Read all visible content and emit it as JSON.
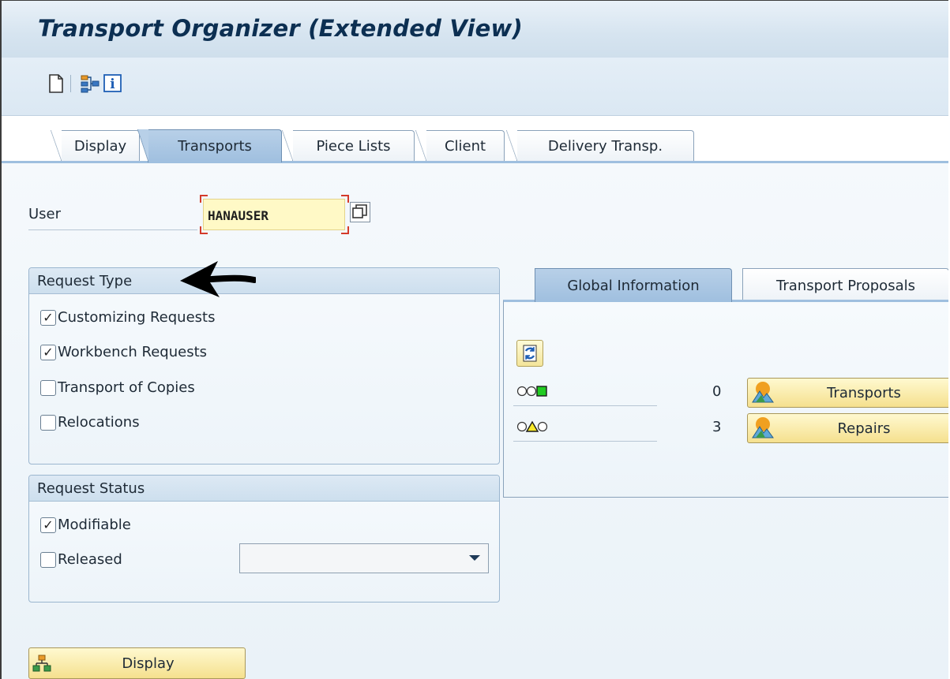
{
  "window": {
    "title": "Transport Organizer (Extended View)"
  },
  "toolbar": {
    "icons": [
      "new-document-icon",
      "hierarchy-icon",
      "info-icon"
    ]
  },
  "tabs": [
    {
      "label": "Display",
      "active": false
    },
    {
      "label": "Transports",
      "active": true
    },
    {
      "label": "Piece Lists",
      "active": false
    },
    {
      "label": "Client",
      "active": false
    },
    {
      "label": "Delivery Transp.",
      "active": false
    }
  ],
  "user": {
    "label": "User",
    "value": "HANAUSER"
  },
  "request_type": {
    "title": "Request Type",
    "items": [
      {
        "label": "Customizing Requests",
        "checked": true
      },
      {
        "label": "Workbench Requests",
        "checked": true
      },
      {
        "label": "Transport of Copies",
        "checked": false
      },
      {
        "label": "Relocations",
        "checked": false
      }
    ]
  },
  "request_status": {
    "title": "Request Status",
    "items": [
      {
        "label": "Modifiable",
        "checked": true
      },
      {
        "label": "Released",
        "checked": false
      }
    ],
    "released_dropdown_value": ""
  },
  "right_tabs": [
    {
      "label": "Global Information",
      "active": true
    },
    {
      "label": "Transport Proposals",
      "active": false
    }
  ],
  "global_info": {
    "rows": [
      {
        "status_icon": "green-status-lights-icon",
        "count": "0",
        "button": "Transports"
      },
      {
        "status_icon": "yellow-status-lights-icon",
        "count": "3",
        "button": "Repairs"
      }
    ]
  },
  "display_button": {
    "label": "Display"
  },
  "colors": {
    "title_text": "#0c2f52",
    "active_tab": "#9fbfdf",
    "input_bg": "#fff9c6",
    "button_yellow": "#f5e08e",
    "required_bracket": "#d43a2a"
  }
}
